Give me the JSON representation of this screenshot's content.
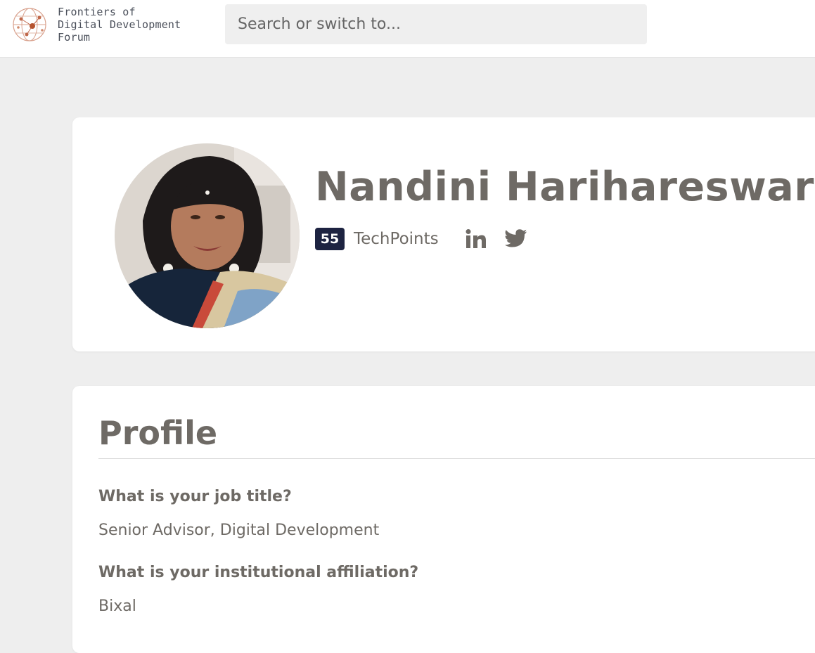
{
  "header": {
    "logo_lines": [
      "Frontiers of",
      "Digital Development",
      "Forum"
    ],
    "search_placeholder": "Search or switch to..."
  },
  "user": {
    "name": "Nandini Harihareswara",
    "techpoints_count": "55",
    "techpoints_label": "TechPoints",
    "social": [
      "linkedin-icon",
      "twitter-icon"
    ]
  },
  "profile": {
    "title": "Profile",
    "fields": [
      {
        "question": "What is your job title?",
        "answer": "Senior Advisor, Digital Development"
      },
      {
        "question": "What is your institutional affiliation?",
        "answer": "Bixal"
      }
    ]
  },
  "colors": {
    "text": "#6e6a65",
    "badge_bg": "#1d2341",
    "logo_accent": "#c0684a",
    "page_bg": "#eeeeee"
  }
}
